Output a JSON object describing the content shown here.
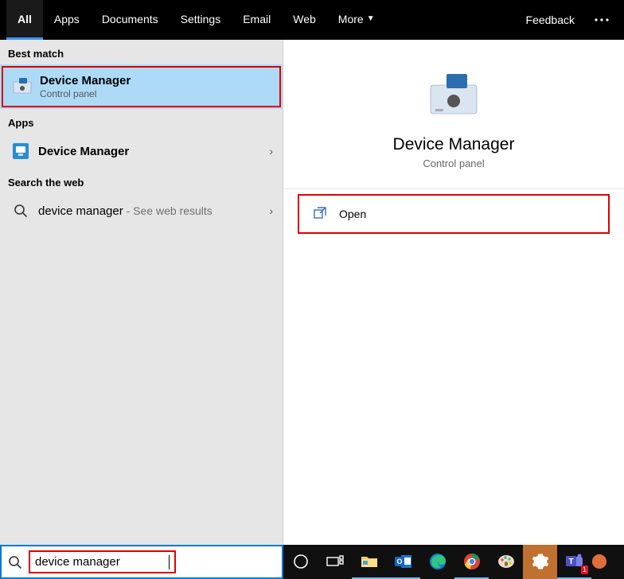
{
  "tabs": {
    "all": "All",
    "apps": "Apps",
    "documents": "Documents",
    "settings": "Settings",
    "email": "Email",
    "web": "Web",
    "more": "More",
    "feedback": "Feedback"
  },
  "sections": {
    "best_match": "Best match",
    "apps": "Apps",
    "search_web": "Search the web"
  },
  "results": {
    "best": {
      "title": "Device Manager",
      "subtitle": "Control panel"
    },
    "app": {
      "title": "Device Manager"
    },
    "web": {
      "title": "device manager",
      "suffix": " - See web results"
    }
  },
  "details": {
    "title": "Device Manager",
    "subtitle": "Control panel",
    "open": "Open"
  },
  "search": {
    "value": "device manager"
  },
  "taskbar": {
    "teams_badge": "1"
  }
}
